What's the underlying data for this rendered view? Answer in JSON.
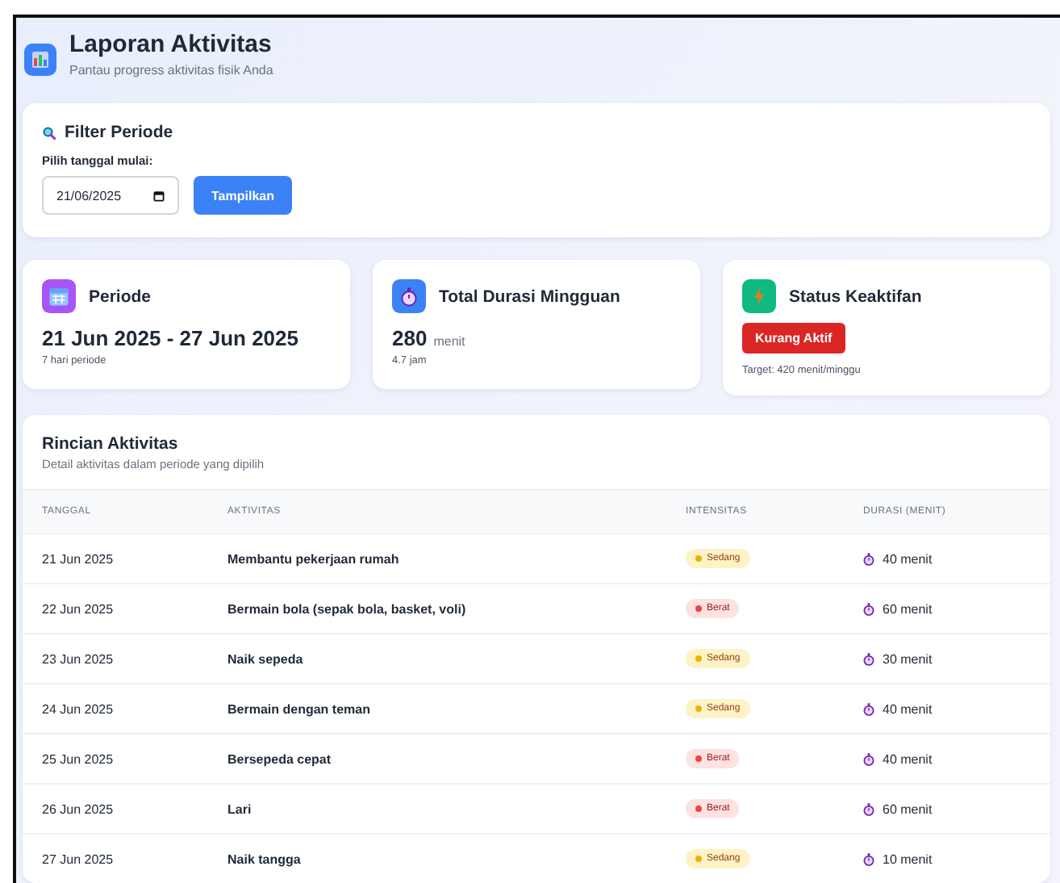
{
  "header": {
    "title": "Laporan Aktivitas",
    "subtitle": "Pantau progress aktivitas fisik Anda"
  },
  "filter": {
    "title": "Filter Periode",
    "label": "Pilih tanggal mulai:",
    "date_value": "21/06/2025",
    "button": "Tampilkan"
  },
  "stats": [
    {
      "kind": "period",
      "title": "Periode",
      "value": "21 Jun 2025 - 27 Jun 2025",
      "note": "7 hari periode"
    },
    {
      "kind": "duration",
      "title": "Total Durasi Mingguan",
      "value": "280",
      "unit": "menit",
      "note": "4.7 jam"
    },
    {
      "kind": "status",
      "title": "Status Keaktifan",
      "status": "Kurang Aktif",
      "note": "Target: 420 menit/minggu"
    }
  ],
  "table": {
    "title": "Rincian Aktivitas",
    "subtitle": "Detail aktivitas dalam periode yang dipilih",
    "columns": [
      "TANGGAL",
      "AKTIVITAS",
      "INTENSITAS",
      "DURASI (MENIT)"
    ],
    "rows": [
      {
        "date": "21 Jun 2025",
        "activity": "Membantu pekerjaan rumah",
        "intensity": {
          "kind": "medium",
          "label": "Sedang"
        },
        "duration": "40 menit"
      },
      {
        "date": "22 Jun 2025",
        "activity": "Bermain bola (sepak bola, basket, voli)",
        "intensity": {
          "kind": "heavy",
          "label": "Berat"
        },
        "duration": "60 menit"
      },
      {
        "date": "23 Jun 2025",
        "activity": "Naik sepeda",
        "intensity": {
          "kind": "medium",
          "label": "Sedang"
        },
        "duration": "30 menit"
      },
      {
        "date": "24 Jun 2025",
        "activity": "Bermain dengan teman",
        "intensity": {
          "kind": "medium",
          "label": "Sedang"
        },
        "duration": "40 menit"
      },
      {
        "date": "25 Jun 2025",
        "activity": "Bersepeda cepat",
        "intensity": {
          "kind": "heavy",
          "label": "Berat"
        },
        "duration": "40 menit"
      },
      {
        "date": "26 Jun 2025",
        "activity": "Lari",
        "intensity": {
          "kind": "heavy",
          "label": "Berat"
        },
        "duration": "60 menit"
      },
      {
        "date": "27 Jun 2025",
        "activity": "Naik tangga",
        "intensity": {
          "kind": "medium",
          "label": "Sedang"
        },
        "duration": "10 menit"
      }
    ]
  }
}
